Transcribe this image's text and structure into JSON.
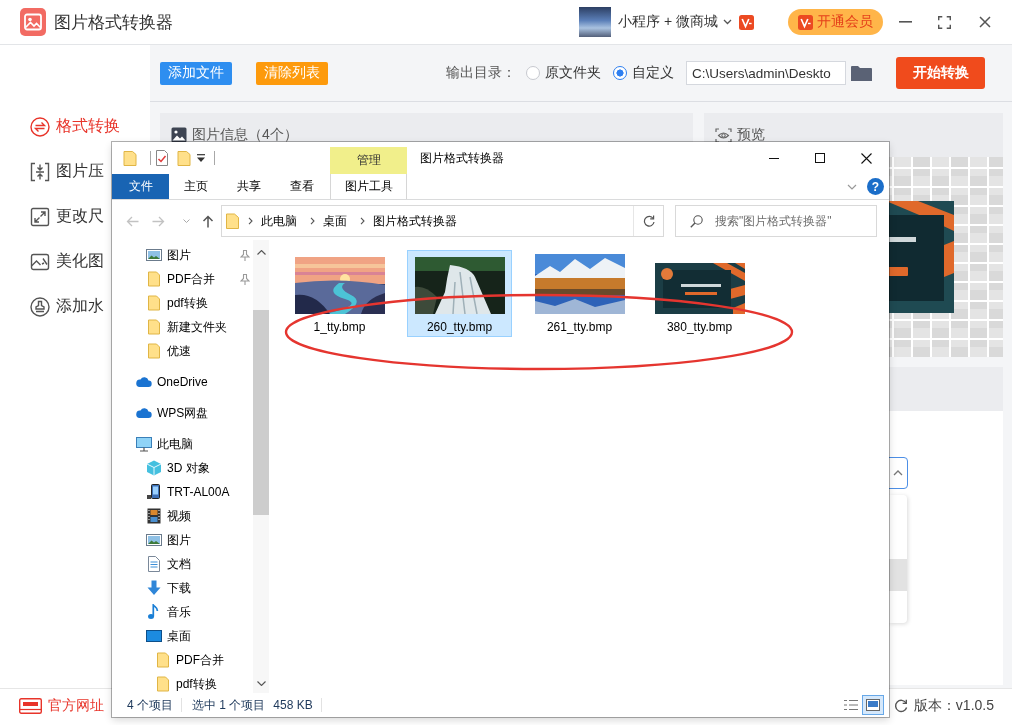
{
  "app": {
    "title": "图片格式转换器",
    "account": "小程序 + 微商城",
    "vip_button": "开通会员"
  },
  "toolbar": {
    "buttons": [
      {
        "label": "添加文件",
        "kind": "add"
      },
      {
        "label": "清除列表",
        "kind": "clear"
      }
    ],
    "output_label": "输出目录：",
    "output_options": [
      {
        "label": "原文件夹",
        "selected": false
      },
      {
        "label": "自定义",
        "selected": true
      }
    ],
    "output_path": "C:\\Users\\admin\\Deskto",
    "start_button": "开始转换"
  },
  "sidebar": {
    "items": [
      {
        "label": "格式转换",
        "kind": "convert",
        "selected": true
      },
      {
        "label": "图片压",
        "kind": "compress",
        "selected": false
      },
      {
        "label": "更改尺",
        "kind": "resize",
        "selected": false
      },
      {
        "label": "美化图",
        "kind": "beautify",
        "selected": false
      },
      {
        "label": "添加水",
        "kind": "watermark",
        "selected": false
      }
    ]
  },
  "panels": {
    "info_title": "图片信息（4个）",
    "preview_title": "预览",
    "dropdown": {
      "expanded": true,
      "options": [
        {
          "selected": false
        },
        {
          "selected": false
        },
        {
          "selected": true
        },
        {
          "selected": false
        }
      ]
    }
  },
  "explorer": {
    "context_tab_group": "管理",
    "title": "图片格式转换器",
    "ribbon_tabs": [
      {
        "label": "文件",
        "kind": "file"
      },
      {
        "label": "主页",
        "kind": "tab"
      },
      {
        "label": "共享",
        "kind": "tab"
      },
      {
        "label": "查看",
        "kind": "tab"
      },
      {
        "label": "图片工具",
        "kind": "context"
      }
    ],
    "help": "?",
    "breadcrumb": [
      "此电脑",
      "桌面",
      "图片格式转换器"
    ],
    "search": {
      "placeholder": "搜索\"图片格式转换器\""
    },
    "nav_pane": {
      "quick_access": [
        {
          "label": "图片",
          "kind": "pictures",
          "pinned": true
        },
        {
          "label": "PDF合并",
          "kind": "folder",
          "pinned": true
        },
        {
          "label": "pdf转换",
          "kind": "folder",
          "pinned": false
        },
        {
          "label": "新建文件夹",
          "kind": "folder",
          "pinned": false
        },
        {
          "label": "优速",
          "kind": "folder",
          "pinned": false
        }
      ],
      "tree": [
        {
          "label": "OneDrive",
          "kind": "cloud"
        },
        {
          "label": "WPS网盘",
          "kind": "cloud"
        },
        {
          "label": "此电脑",
          "kind": "computer",
          "children": [
            {
              "label": "3D 对象",
              "kind": "cube"
            },
            {
              "label": "TRT-AL00A",
              "kind": "phone"
            },
            {
              "label": "视频",
              "kind": "video"
            },
            {
              "label": "图片",
              "kind": "pictures"
            },
            {
              "label": "文档",
              "kind": "document"
            },
            {
              "label": "下载",
              "kind": "download"
            },
            {
              "label": "音乐",
              "kind": "music"
            },
            {
              "label": "桌面",
              "kind": "desktop",
              "children": [
                {
                  "label": "PDF合并",
                  "kind": "folder"
                },
                {
                  "label": "pdf转换",
                  "kind": "folder"
                }
              ]
            }
          ]
        }
      ]
    },
    "files": [
      {
        "name": "1_tty.bmp",
        "kind": "sunset",
        "selected": false
      },
      {
        "name": "260_tty.bmp",
        "kind": "waterfall",
        "selected": true
      },
      {
        "name": "261_tty.bmp",
        "kind": "mountains",
        "selected": false
      },
      {
        "name": "380_tty.bmp",
        "kind": "slide",
        "selected": false
      }
    ],
    "status_bar": {
      "item_count": "4 个项目",
      "selection": "选中 1 个项目",
      "size": "458 KB"
    },
    "view_buttons": [
      {
        "kind": "details",
        "selected": false
      },
      {
        "kind": "thumbnails",
        "selected": true
      }
    ]
  },
  "footer": {
    "website_link": "官方网址",
    "version": "版本：v1.0.5"
  }
}
